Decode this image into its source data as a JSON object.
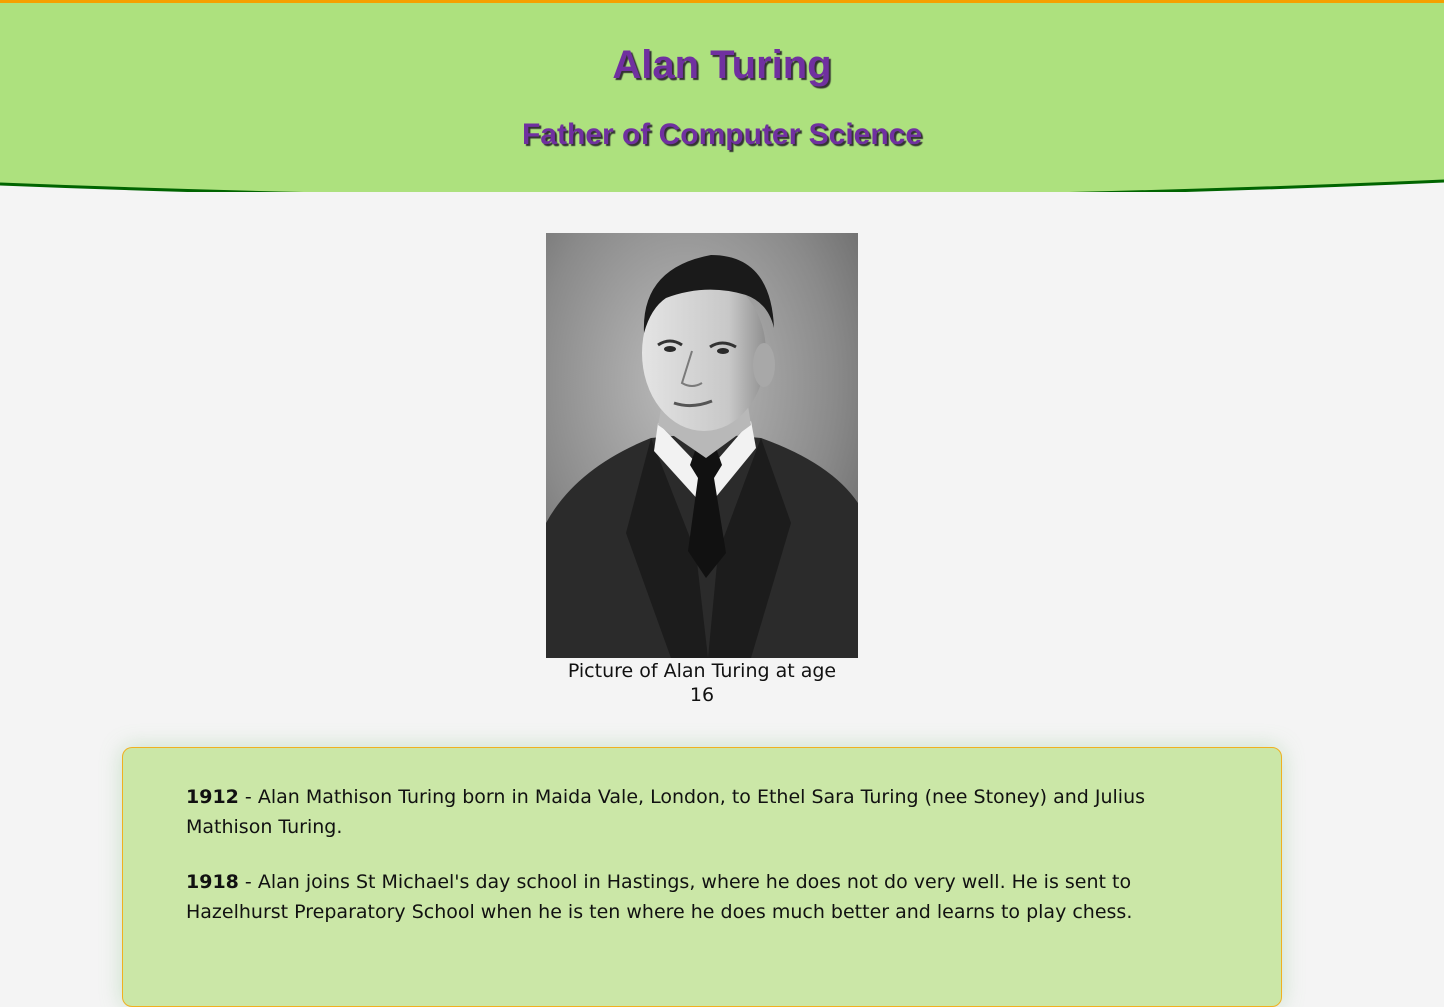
{
  "header": {
    "title": "Alan Turing",
    "subtitle": "Father of Computer Science",
    "colors": {
      "top_border": "#f5a000",
      "background": "#ade17e",
      "curve_line": "#006400",
      "title_text": "#7030a0"
    }
  },
  "figure": {
    "image_alt": "Picture of Alan Turing at age 16",
    "caption": "Picture of Alan Turing at age 16"
  },
  "timeline": {
    "background": "#cbe7a7",
    "border": "#f0b020",
    "entries": [
      {
        "year": "1912",
        "text": " - Alan Mathison Turing born in Maida Vale, London, to Ethel Sara Turing (nee Stoney) and Julius Mathison Turing."
      },
      {
        "year": "1918",
        "text": " - Alan joins St Michael's day school in Hastings, where he does not do very well. He is sent to Hazelhurst Preparatory School when he is ten where he does much better and learns to play chess."
      }
    ]
  }
}
